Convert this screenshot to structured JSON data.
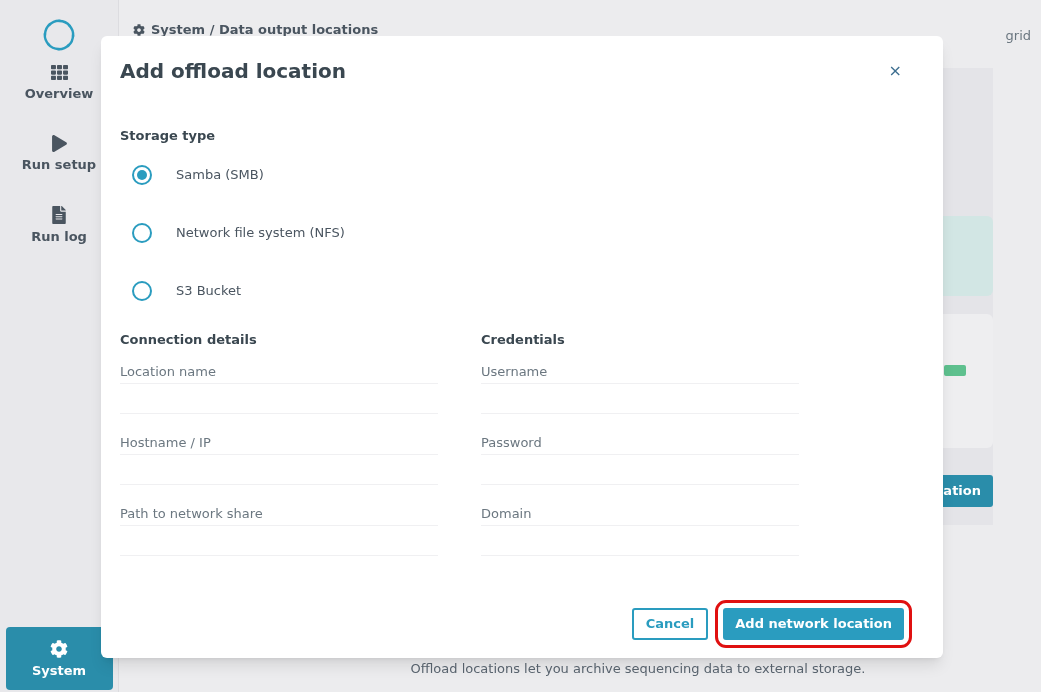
{
  "sidebar": {
    "items": [
      {
        "label": "Overview",
        "kind": "overview",
        "selected": false
      },
      {
        "label": "Run setup",
        "kind": "setup",
        "selected": false
      },
      {
        "label": "Run log",
        "kind": "log",
        "selected": false
      },
      {
        "label": "System",
        "kind": "system",
        "selected": true
      }
    ]
  },
  "breadcrumb": "System / Data output locations",
  "header_right": "grid",
  "background": {
    "button_fragment": "ation",
    "footer_text": "Offload locations let you archive sequencing data to external storage."
  },
  "dialog": {
    "title": "Add offload location",
    "close": "×",
    "storage_type": {
      "heading": "Storage type",
      "options": [
        {
          "label": "Samba (SMB)",
          "selected": true
        },
        {
          "label": "Network file system (NFS)",
          "selected": false
        },
        {
          "label": "S3 Bucket",
          "selected": false
        }
      ]
    },
    "connection": {
      "heading": "Connection details",
      "fields": [
        {
          "label": "Location name"
        },
        {
          "label": "Hostname / IP"
        },
        {
          "label": "Path to network share"
        }
      ]
    },
    "credentials": {
      "heading": "Credentials",
      "fields": [
        {
          "label": "Username"
        },
        {
          "label": "Password"
        },
        {
          "label": "Domain"
        }
      ]
    },
    "buttons": [
      {
        "label": "Cancel",
        "kind": "secondary",
        "highlighted": false
      },
      {
        "label": "Add network location",
        "kind": "primary",
        "highlighted": true
      }
    ]
  }
}
